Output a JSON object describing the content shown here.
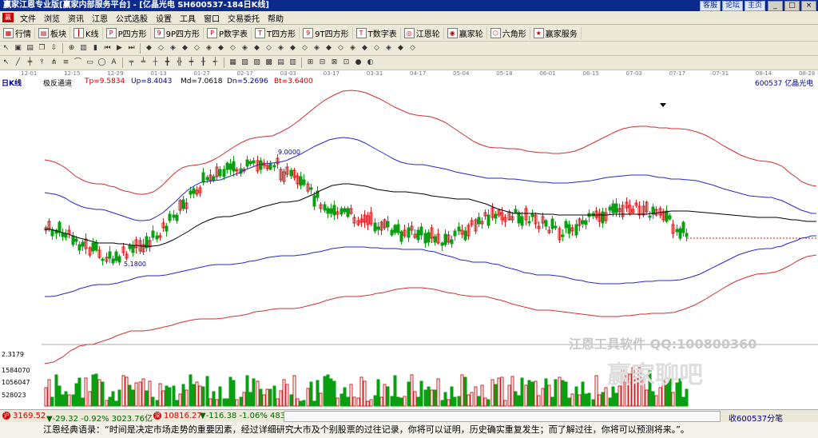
{
  "window": {
    "title": "赢家江恩专业版[赢家内部服务平台] - [亿晶光电  SH600537-184日K线]",
    "links": [
      "客服",
      "论坛",
      "主页"
    ],
    "controls": [
      "_",
      "□",
      "×"
    ]
  },
  "menu": [
    "文件",
    "浏览",
    "资讯",
    "江恩",
    "公式选股",
    "设置",
    "工具",
    "窗口",
    "交易委托",
    "帮助"
  ],
  "toolbar_main": [
    {
      "label": "行情",
      "icon": "grid-icon"
    },
    {
      "label": "板块",
      "icon": "block-icon"
    },
    {
      "label": "K线",
      "icon": "candle-icon"
    },
    {
      "label": "P四方形",
      "icon": "p-square-icon"
    },
    {
      "label": "9P四方形",
      "icon": "9p-square-icon"
    },
    {
      "label": "P数字表",
      "icon": "p-table-icon"
    },
    {
      "label": "T四方形",
      "icon": "t-square-icon"
    },
    {
      "label": "9T四方形",
      "icon": "9t-square-icon"
    },
    {
      "label": "T数字表",
      "icon": "t-table-icon"
    },
    {
      "label": "江恩轮",
      "icon": "gann-wheel-icon"
    },
    {
      "label": "赢家轮",
      "icon": "winner-wheel-icon"
    },
    {
      "label": "六角形",
      "icon": "hexagon-icon"
    },
    {
      "label": "赢家服务",
      "icon": "service-icon"
    }
  ],
  "chart": {
    "period_label": "日K线",
    "indicator_name": "极反通道",
    "params": {
      "Tp": "Tp=9.5834",
      "Up": "Up=8.4043",
      "Md": "Md=7.0618",
      "Dn": "Dn=5.2696",
      "Bt": "Bt=3.6400"
    },
    "stock_label": "600537  亿晶光电",
    "date_ticks": [
      "12-01",
      "12-15",
      "12-29",
      "01-13",
      "01-27",
      "02-17",
      "03-03",
      "03-17",
      "03-31",
      "04-17",
      "05-04",
      "05-18",
      "06-01",
      "06-15",
      "07-03",
      "07-17",
      "07-31",
      "08-14",
      "08-28"
    ],
    "high_label": "9.0000",
    "low_label": "5.1800",
    "volume_scale": [
      "2.3179",
      "1584070",
      "1056047",
      "528023"
    ],
    "watermark_1": "江恩工具软件  QQ:100800360",
    "watermark_2": "赢家聊吧"
  },
  "status": {
    "sh_index": "3169.52",
    "sh_change": "▼-29.32 -0.92% 3023.76亿",
    "sz_index": "10816.27",
    "sz_change": "▼-116.38 -1.06% 4832",
    "right": "收600537分笔"
  },
  "quote": "江恩经典语录：“时间是决定市场走势的重要因素，经过详细研究大市及个别股票的过往记录，你将可以证明，历史确实重复发生；而了解过往，你将可以预测将来。”。"
}
